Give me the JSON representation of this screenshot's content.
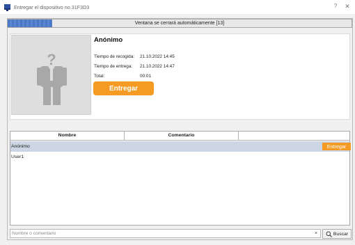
{
  "window": {
    "title": "Entregar el dispositivo no.31F3D3",
    "help_label": "?",
    "close_label": "✕"
  },
  "progress": {
    "text": "Ventana se cerrará automáticamente [13]",
    "fraction": 0.13
  },
  "user": {
    "name": "Anónimo",
    "rows": [
      {
        "label": "Tiempo de recogida:",
        "value": "21.10.2022 14:45"
      },
      {
        "label": "Tiempo de entrega:",
        "value": "21.10.2022 14:47"
      },
      {
        "label": "Total:",
        "value": "00:01"
      }
    ],
    "deliver_label": "Entregar"
  },
  "grid": {
    "columns": [
      "Nombre",
      "Comentario",
      ""
    ],
    "rows": [
      {
        "name": "Anónimo",
        "comment": "",
        "selected": true,
        "action_label": "Entregar"
      },
      {
        "name": "User1",
        "comment": "",
        "selected": false
      }
    ]
  },
  "search": {
    "placeholder": "Nombre o comentario",
    "value": "",
    "clear_label": "×",
    "button_label": "Buscar"
  },
  "colors": {
    "accent": "#f59a23",
    "progress": "#4b78c4",
    "selected_row": "#cbd5e4"
  }
}
